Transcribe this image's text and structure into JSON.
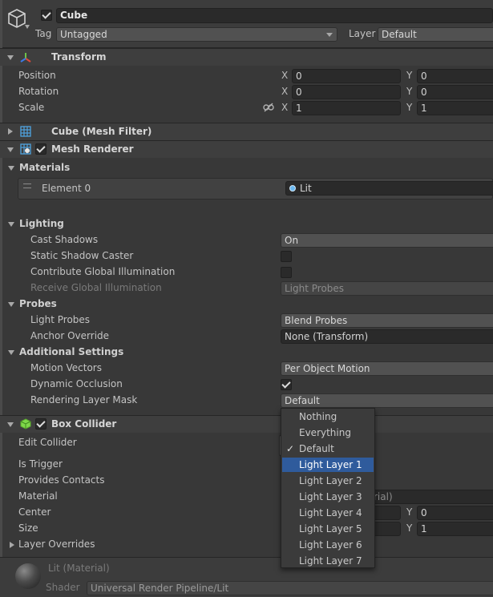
{
  "object": {
    "name": "Cube",
    "tag_label": "Tag",
    "tag_value": "Untagged",
    "layer_label": "Layer",
    "layer_value": "Default"
  },
  "transform": {
    "title": "Transform",
    "position_label": "Position",
    "rotation_label": "Rotation",
    "scale_label": "Scale",
    "x_label": "X",
    "y_label": "Y",
    "position_x": "0",
    "position_y": "0",
    "rotation_x": "0",
    "rotation_y": "0",
    "scale_x": "1",
    "scale_y": "1"
  },
  "mesh_filter": {
    "title": "Cube (Mesh Filter)"
  },
  "mesh_renderer": {
    "title": "Mesh Renderer",
    "materials_label": "Materials",
    "element0_label": "Element 0",
    "element0_value": "Lit",
    "lighting_label": "Lighting",
    "cast_shadows_label": "Cast Shadows",
    "cast_shadows_value": "On",
    "static_shadow_label": "Static Shadow Caster",
    "contribute_gi_label": "Contribute Global Illumination",
    "receive_gi_label": "Receive Global Illumination",
    "receive_gi_value": "Light Probes",
    "probes_label": "Probes",
    "light_probes_label": "Light Probes",
    "light_probes_value": "Blend Probes",
    "anchor_override_label": "Anchor Override",
    "anchor_override_value": "None (Transform)",
    "additional_label": "Additional Settings",
    "motion_vectors_label": "Motion Vectors",
    "motion_vectors_value": "Per Object Motion",
    "dynamic_occlusion_label": "Dynamic Occlusion",
    "rendering_layer_label": "Rendering Layer Mask",
    "rendering_layer_value": "Default"
  },
  "box_collider": {
    "title": "Box Collider",
    "edit_collider_label": "Edit Collider",
    "is_trigger_label": "Is Trigger",
    "provides_contacts_label": "Provides Contacts",
    "material_label": "Material",
    "material_value_tail": "rial)",
    "center_label": "Center",
    "size_label": "Size",
    "center_y_label": "Y",
    "center_y": "0",
    "size_y_label": "Y",
    "size_y": "1",
    "layer_overrides_label": "Layer Overrides"
  },
  "material_preview": {
    "name": "Lit (Material)",
    "shader_label": "Shader",
    "shader_value": "Universal Render Pipeline/Lit"
  },
  "layer_menu": {
    "items": [
      "Nothing",
      "Everything",
      "Default",
      "Light Layer 1",
      "Light Layer 2",
      "Light Layer 3",
      "Light Layer 4",
      "Light Layer 5",
      "Light Layer 6",
      "Light Layer 7"
    ],
    "checked": "Default",
    "highlighted": "Light Layer 1",
    "check_glyph": "✓"
  },
  "colors": {
    "background": "#383838",
    "header": "#3e3e3e",
    "field": "#2a2a2a",
    "highlight": "#2f5b9c"
  }
}
